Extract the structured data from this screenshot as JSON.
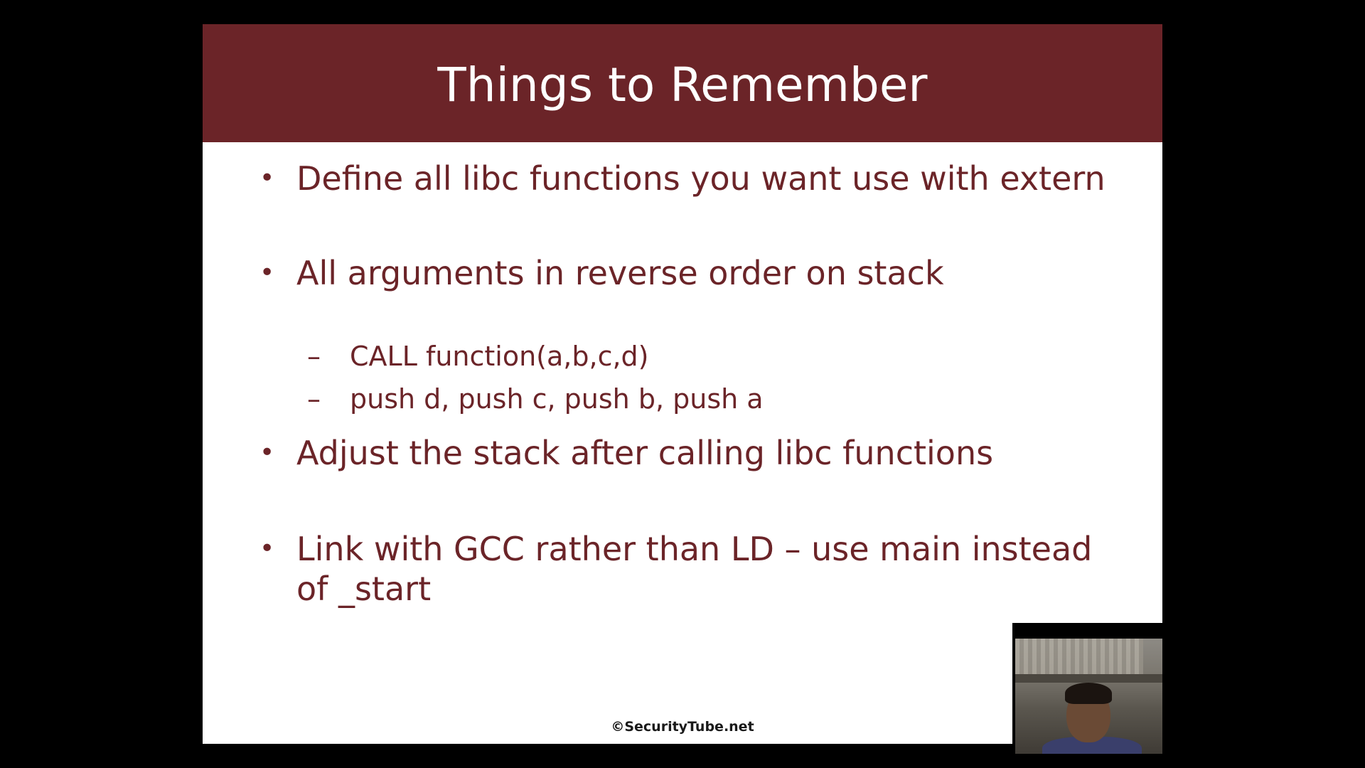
{
  "slide": {
    "title": "Things to Remember",
    "bullets": [
      {
        "text": "Define all libc functions you want use with extern"
      },
      {
        "text": "All arguments in reverse order on stack",
        "subitems": [
          "CALL function(a,b,c,d)",
          "push d, push c, push b, push a"
        ]
      },
      {
        "text": "Adjust the stack after calling libc functions"
      },
      {
        "text": "Link with GCC rather than LD – use main instead of _start"
      }
    ],
    "bullet_glyph": "•",
    "dash_glyph": "–",
    "footer": "©SecurityTube.net"
  },
  "colors": {
    "header_bg": "#6b2428",
    "body_text": "#6b2428",
    "slide_bg": "#ffffff",
    "frame_bg": "#000000"
  },
  "webcam": {
    "icon": "presenter-video-thumbnail"
  }
}
